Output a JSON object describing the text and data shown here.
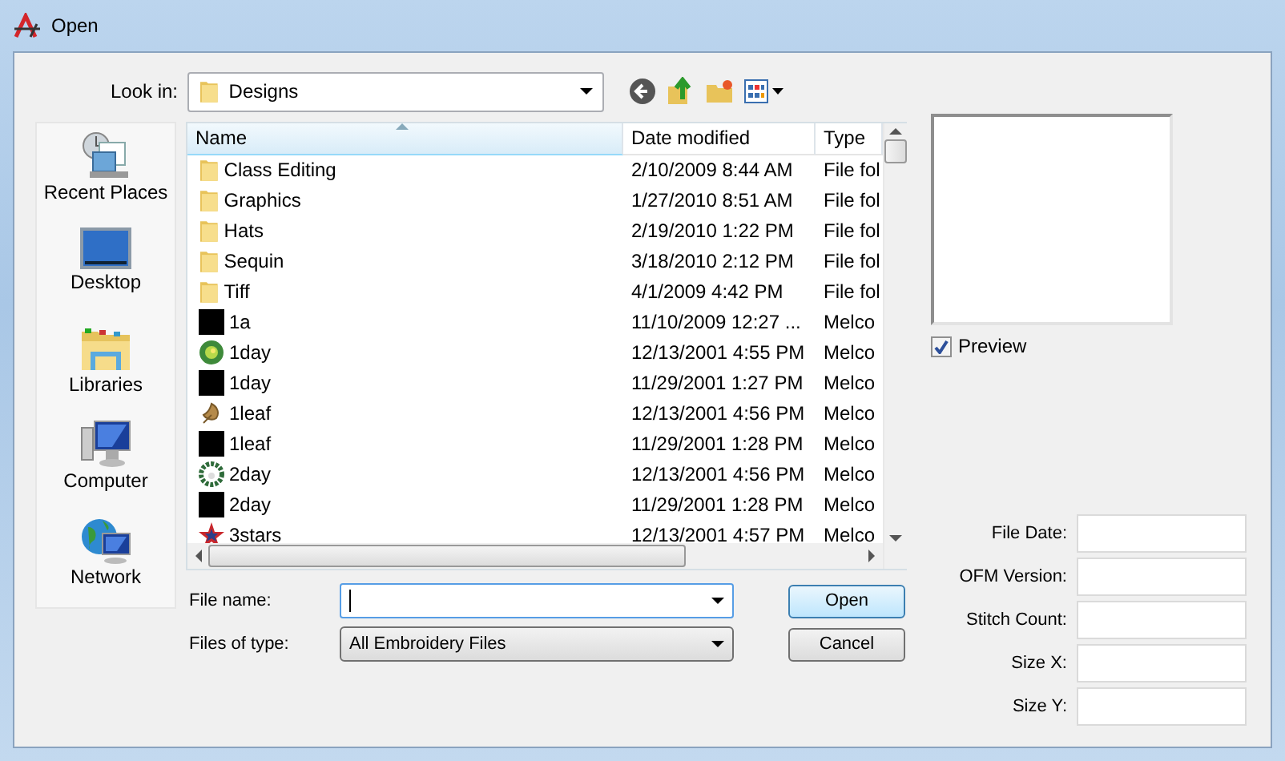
{
  "window": {
    "title": "Open"
  },
  "look_in": {
    "label": "Look in:",
    "value": "Designs"
  },
  "sidebar": {
    "items": [
      {
        "label": "Recent Places",
        "kind": "recent"
      },
      {
        "label": "Desktop",
        "kind": "desktop"
      },
      {
        "label": "Libraries",
        "kind": "libraries"
      },
      {
        "label": "Computer",
        "kind": "computer"
      },
      {
        "label": "Network",
        "kind": "network"
      }
    ]
  },
  "table": {
    "columns": [
      "Name",
      "Date modified",
      "Type"
    ],
    "rows": [
      {
        "name": "Class Editing",
        "date": "2/10/2009 8:44 AM",
        "type": "File fol",
        "kind": "folder"
      },
      {
        "name": "Graphics",
        "date": "1/27/2010 8:51 AM",
        "type": "File fol",
        "kind": "folder"
      },
      {
        "name": "Hats",
        "date": "2/19/2010 1:22 PM",
        "type": "File fol",
        "kind": "folder"
      },
      {
        "name": "Sequin",
        "date": "3/18/2010 2:12 PM",
        "type": "File fol",
        "kind": "folder"
      },
      {
        "name": "Tiff",
        "date": "4/1/2009 4:42 PM",
        "type": "File fol",
        "kind": "folder"
      },
      {
        "name": "1a",
        "date": "11/10/2009 12:27 ...",
        "type": "Melco",
        "kind": "blank"
      },
      {
        "name": "1day",
        "date": "12/13/2001 4:55 PM",
        "type": "Melco",
        "kind": "sun"
      },
      {
        "name": "1day",
        "date": "11/29/2001 1:27 PM",
        "type": "Melco",
        "kind": "blank"
      },
      {
        "name": "1leaf",
        "date": "12/13/2001 4:56 PM",
        "type": "Melco",
        "kind": "leaf"
      },
      {
        "name": "1leaf",
        "date": "11/29/2001 1:28 PM",
        "type": "Melco",
        "kind": "blank"
      },
      {
        "name": "2day",
        "date": "12/13/2001 4:56 PM",
        "type": "Melco",
        "kind": "wreath"
      },
      {
        "name": "2day",
        "date": "11/29/2001 1:28 PM",
        "type": "Melco",
        "kind": "blank"
      },
      {
        "name": "3stars",
        "date": "12/13/2001 4:57 PM",
        "type": "Melco",
        "kind": "star"
      }
    ]
  },
  "preview": {
    "label": "Preview",
    "checked": true
  },
  "file_name": {
    "label": "File name:"
  },
  "file_type": {
    "label": "Files of type:",
    "value": "All Embroidery Files"
  },
  "buttons": [
    "Open",
    "Cancel"
  ],
  "info_fields": [
    "File Date:",
    "OFM Version:",
    "Stitch Count:",
    "Size X:",
    "Size Y:"
  ]
}
